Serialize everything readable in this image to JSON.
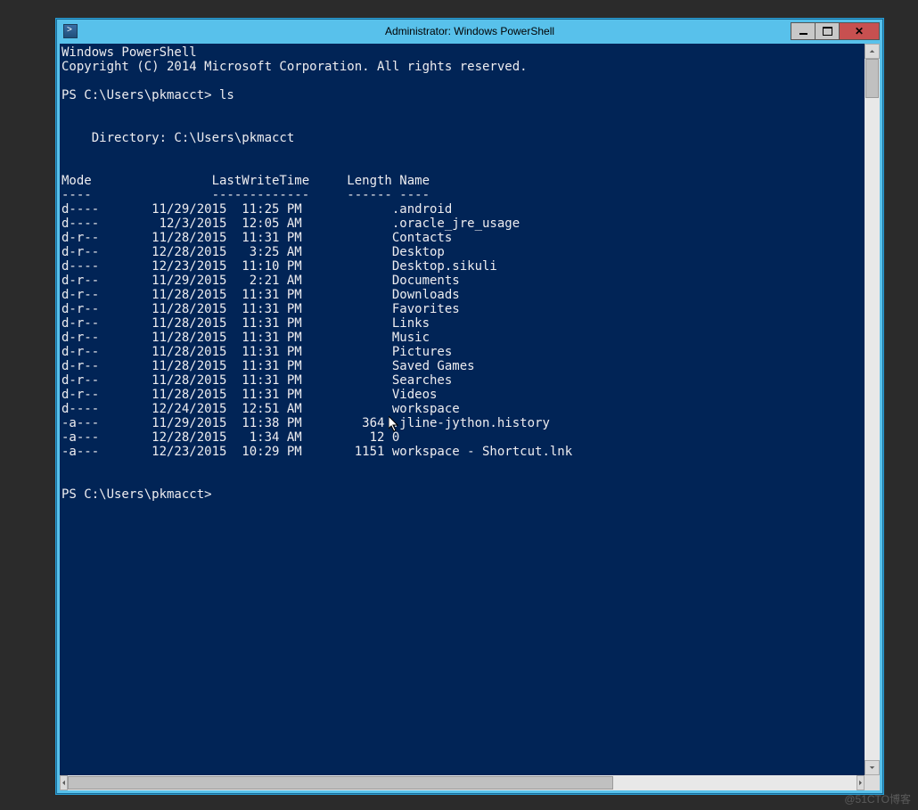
{
  "window": {
    "title": "Administrator: Windows PowerShell"
  },
  "terminal": {
    "banner1": "Windows PowerShell",
    "banner2": "Copyright (C) 2014 Microsoft Corporation. All rights reserved.",
    "prompt1": "PS C:\\Users\\pkmacct> ls",
    "dirline": "    Directory: C:\\Users\\pkmacct",
    "header": "Mode                LastWriteTime     Length Name",
    "divider": "----                -------------     ------ ----",
    "rows": [
      {
        "mode": "d----",
        "date": "11/29/2015",
        "time": "11:25 PM",
        "len": "",
        "name": ".android"
      },
      {
        "mode": "d----",
        "date": "12/3/2015",
        "time": "12:05 AM",
        "len": "",
        "name": ".oracle_jre_usage"
      },
      {
        "mode": "d-r--",
        "date": "11/28/2015",
        "time": "11:31 PM",
        "len": "",
        "name": "Contacts"
      },
      {
        "mode": "d-r--",
        "date": "12/28/2015",
        "time": "3:25 AM",
        "len": "",
        "name": "Desktop"
      },
      {
        "mode": "d----",
        "date": "12/23/2015",
        "time": "11:10 PM",
        "len": "",
        "name": "Desktop.sikuli"
      },
      {
        "mode": "d-r--",
        "date": "11/29/2015",
        "time": "2:21 AM",
        "len": "",
        "name": "Documents"
      },
      {
        "mode": "d-r--",
        "date": "11/28/2015",
        "time": "11:31 PM",
        "len": "",
        "name": "Downloads"
      },
      {
        "mode": "d-r--",
        "date": "11/28/2015",
        "time": "11:31 PM",
        "len": "",
        "name": "Favorites"
      },
      {
        "mode": "d-r--",
        "date": "11/28/2015",
        "time": "11:31 PM",
        "len": "",
        "name": "Links"
      },
      {
        "mode": "d-r--",
        "date": "11/28/2015",
        "time": "11:31 PM",
        "len": "",
        "name": "Music"
      },
      {
        "mode": "d-r--",
        "date": "11/28/2015",
        "time": "11:31 PM",
        "len": "",
        "name": "Pictures"
      },
      {
        "mode": "d-r--",
        "date": "11/28/2015",
        "time": "11:31 PM",
        "len": "",
        "name": "Saved Games"
      },
      {
        "mode": "d-r--",
        "date": "11/28/2015",
        "time": "11:31 PM",
        "len": "",
        "name": "Searches"
      },
      {
        "mode": "d-r--",
        "date": "11/28/2015",
        "time": "11:31 PM",
        "len": "",
        "name": "Videos"
      },
      {
        "mode": "d----",
        "date": "12/24/2015",
        "time": "12:51 AM",
        "len": "",
        "name": "workspace"
      },
      {
        "mode": "-a---",
        "date": "11/29/2015",
        "time": "11:38 PM",
        "len": "364",
        "name": ".jline-jython.history"
      },
      {
        "mode": "-a---",
        "date": "12/28/2015",
        "time": "1:34 AM",
        "len": "12",
        "name": "0"
      },
      {
        "mode": "-a---",
        "date": "12/23/2015",
        "time": "10:29 PM",
        "len": "1151",
        "name": "workspace - Shortcut.lnk"
      }
    ],
    "prompt2": "PS C:\\Users\\pkmacct>"
  },
  "watermark": "@51CTO博客"
}
